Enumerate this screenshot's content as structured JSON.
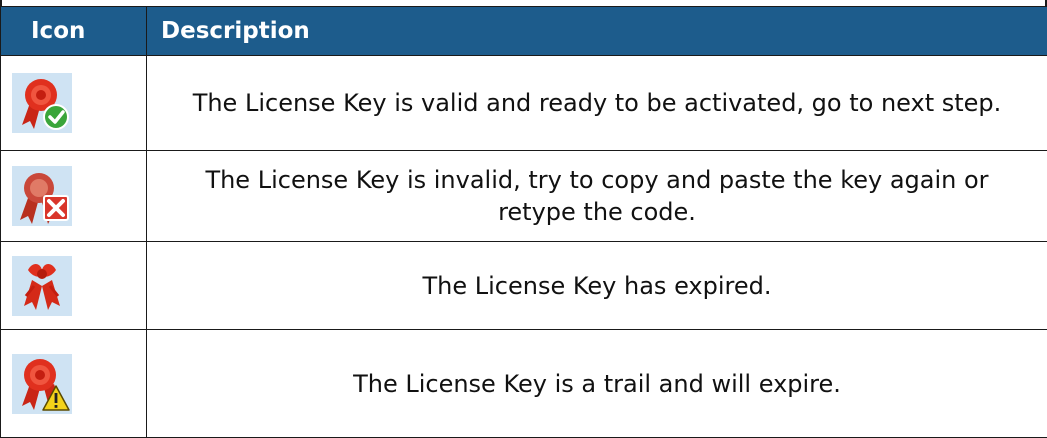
{
  "table": {
    "headers": {
      "icon": "Icon",
      "description": "Description"
    },
    "rows": [
      {
        "icon": "license-valid-icon",
        "description": "The License Key is valid and ready to be activated, go to next step."
      },
      {
        "icon": "license-invalid-icon",
        "description": "The License Key is invalid, try to copy and paste the key again or retype the code."
      },
      {
        "icon": "license-expired-icon",
        "description": "The License Key has expired."
      },
      {
        "icon": "license-trial-warning-icon",
        "description": "The License Key is a trail and will expire."
      }
    ]
  },
  "colors": {
    "header_background": "#1d5c8c",
    "header_text": "#ffffff",
    "icon_background": "#cfe3f3",
    "ribbon_red": "#e0301e",
    "valid_green": "#3aa53a",
    "invalid_red": "#d9352a",
    "warning_yellow": "#f3d21a"
  }
}
